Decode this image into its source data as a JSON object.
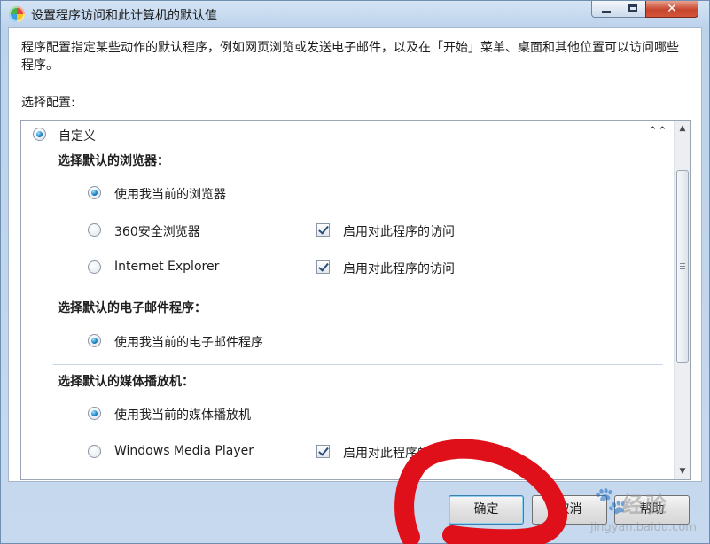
{
  "window": {
    "title": "设置程序访问和此计算机的默认值",
    "close_glyph": "✕"
  },
  "description": "程序配置指定某些动作的默认程序，例如网页浏览或发送电子邮件，以及在「开始」菜单、桌面和其他位置可以访问哪些程序。",
  "select_config_label": "选择配置:",
  "config": {
    "name": "自定义",
    "selected": true,
    "collapse_icon": "chevron-double-up-icon",
    "collapse_glyph": "⌃⌃",
    "sections": [
      {
        "heading": "选择默认的浏览器：",
        "options": [
          {
            "label": "使用我当前的浏览器",
            "selected": true
          },
          {
            "label": "360安全浏览器",
            "selected": false,
            "access_label": "启用对此程序的访问",
            "access_checked": true
          },
          {
            "label": "Internet Explorer",
            "selected": false,
            "access_label": "启用对此程序的访问",
            "access_checked": true
          }
        ]
      },
      {
        "heading": "选择默认的电子邮件程序：",
        "options": [
          {
            "label": "使用我当前的电子邮件程序",
            "selected": true
          }
        ]
      },
      {
        "heading": "选择默认的媒体播放机：",
        "options": [
          {
            "label": "使用我当前的媒体播放机",
            "selected": true
          },
          {
            "label": "Windows Media Player",
            "selected": false,
            "access_label": "启用对此程序的访问",
            "access_checked": true
          }
        ]
      }
    ]
  },
  "scrollbar": {
    "up_glyph": "▲",
    "down_glyph": "▼"
  },
  "buttons": {
    "ok": "确定",
    "cancel": "取消",
    "help": "帮助"
  },
  "annotation_color": "#e0101a",
  "watermark": {
    "paw_glyph": "🐾",
    "cn": "经验",
    "en": "jingyan.baidu.com"
  }
}
